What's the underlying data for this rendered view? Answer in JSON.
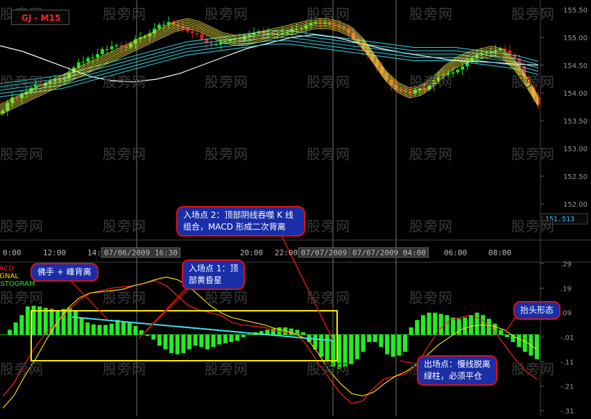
{
  "title": "GJ - M15",
  "watermark": "股旁网",
  "price_axis": {
    "ticks": [
      "155.50",
      "155.00",
      "154.50",
      "154.00",
      "153.50",
      "153.00",
      "152.50",
      "152.00"
    ],
    "current_price": "151.513"
  },
  "time_axis": {
    "labels": [
      "0:00",
      "12:00",
      "14:00",
      "07/06/2009 16:30",
      "20:00",
      "22:00",
      "07/07/2009 01",
      "07/07/2009 04:00",
      "06:00",
      "08:00"
    ]
  },
  "macd_axis": {
    "ticks": [
      ".29",
      ".19",
      ".09",
      "-.01",
      "-.11",
      "-.21",
      "-.31"
    ]
  },
  "legend": {
    "macd": "MACD",
    "signal": "SIGNAL",
    "histogram": "HISTOGRAM"
  },
  "callouts": {
    "entry2_line1": "入场点 2：顶部阴线吞噬 K 线",
    "entry2_line2": "组合，MACD 形成二次背离",
    "hook": "佛手 + 峰背离",
    "entry1_line1": "入场点 1：顶",
    "entry1_line2": "部黄昏星",
    "raise": "抬头形态",
    "exit_line1": "出场点：慢线脱离",
    "exit_line2": "绿柱，必须平仓"
  },
  "colors": {
    "bg": "#000000",
    "bull": "#22dd22",
    "bear": "#dd2222",
    "ma_yellow": "#ffee44",
    "ma_cyan": "#33ddee",
    "ma_white": "#ffffff",
    "macd": "#ff2020",
    "signal": "#ffdd00",
    "hist": "#22ee22",
    "callout_bg": "#1a2ea8",
    "callout_border": "#e01010",
    "box": "#ffee00"
  },
  "chart_data": [
    {
      "type": "candlestick",
      "title": "GJ - M15",
      "ylim": [
        151.4,
        155.6
      ],
      "close": [
        153.68,
        153.82,
        153.92,
        153.91,
        153.98,
        154.02,
        154.1,
        154.17,
        154.13,
        154.18,
        154.21,
        154.23,
        154.24,
        154.26,
        154.36,
        154.46,
        154.55,
        154.56,
        154.63,
        154.64,
        154.7,
        154.79,
        154.79,
        154.84,
        154.86,
        154.84,
        154.82,
        154.89,
        154.97,
        155.0,
        155.02,
        155.07,
        155.16,
        155.23,
        155.23,
        155.28,
        155.23,
        155.2,
        155.17,
        155.11,
        155.08,
        155.06,
        154.97,
        154.9,
        154.88,
        154.88,
        154.92,
        154.93,
        154.96,
        154.97,
        154.96,
        155.03,
        155.05,
        155.08,
        155.11,
        155.07,
        155.08,
        155.06,
        155.06,
        155.08,
        155.1,
        155.15,
        155.15,
        155.16,
        155.22,
        155.26,
        155.27,
        155.26,
        155.27,
        155.23,
        155.22,
        155.19,
        155.16,
        155.08,
        154.97,
        154.89,
        154.77,
        154.68,
        154.59,
        154.47,
        154.36,
        154.24,
        154.14,
        154.07,
        154.04,
        154.02,
        153.99,
        154.05,
        154.08,
        154.06,
        154.13,
        154.22,
        154.28,
        154.32,
        154.35,
        154.37,
        154.42,
        154.48,
        154.56,
        154.63,
        154.69,
        154.72,
        154.73,
        154.74,
        154.77,
        154.8,
        154.77,
        154.69,
        154.62,
        154.48,
        154.29,
        154.12,
        153.93,
        153.79
      ],
      "ma_fast_yellow": [
        153.7,
        153.8,
        153.9,
        154.0,
        154.1,
        154.2,
        154.3,
        154.4,
        154.5,
        154.6,
        154.7,
        154.8,
        154.9,
        155.0,
        155.1,
        155.2,
        155.25,
        155.2,
        155.1,
        155.0,
        154.95,
        154.95,
        155.0,
        155.05,
        155.1,
        155.15,
        155.2,
        155.25,
        155.25,
        155.2,
        155.1,
        154.9,
        154.6,
        154.3,
        154.1,
        154.0,
        154.05,
        154.2,
        154.4,
        154.55,
        154.65,
        154.7,
        154.75,
        154.7,
        154.5,
        154.2,
        153.85
      ],
      "ma_slow_cyan": [
        154.05,
        154.1,
        154.15,
        154.2,
        154.3,
        154.4,
        154.5,
        154.6,
        154.7,
        154.8,
        154.85,
        154.9,
        154.95,
        155.0,
        155.0,
        154.95,
        154.9,
        154.85,
        154.8,
        154.75,
        154.7,
        154.7,
        154.7,
        154.65,
        154.6,
        154.55,
        154.45
      ],
      "ma_slow_white": [
        154.85,
        154.75,
        154.6,
        154.45,
        154.3,
        154.22,
        154.2,
        154.25,
        154.35,
        154.5,
        154.65,
        154.8,
        154.9,
        155.0,
        155.05,
        155.0,
        154.9,
        154.8,
        154.72,
        154.66,
        154.6,
        154.57,
        154.55,
        154.52,
        154.5
      ],
      "yticks": [
        "155.50",
        "155.00",
        "154.50",
        "154.00",
        "153.50",
        "153.00",
        "152.50",
        "152.00"
      ],
      "last_price": "151.513"
    },
    {
      "type": "macd",
      "series_names": [
        "MACD",
        "SIGNAL",
        "HISTOGRAM"
      ],
      "ylim": [
        -0.31,
        0.29
      ],
      "histogram": [
        0.02,
        0.05,
        0.08,
        0.115,
        0.118,
        0.115,
        0.11,
        0.105,
        0.1,
        0.105,
        0.11,
        0.1,
        0.07,
        0.05,
        0.042,
        0.04,
        0.04,
        0.045,
        0.06,
        0.055,
        0.05,
        0.035,
        0.018,
        -0.005,
        -0.02,
        -0.045,
        -0.06,
        -0.075,
        -0.08,
        -0.075,
        -0.06,
        -0.045,
        -0.05,
        -0.06,
        -0.05,
        -0.04,
        -0.035,
        -0.03,
        -0.025,
        -0.01,
        0.002,
        0.01,
        0.015,
        0.02,
        0.025,
        0.03,
        0.03,
        0.025,
        0.02,
        0.01,
        -0.03,
        -0.06,
        -0.09,
        -0.11,
        -0.13,
        -0.14,
        -0.13,
        -0.12,
        -0.1,
        -0.07,
        -0.03,
        -0.03,
        -0.05,
        -0.08,
        -0.09,
        -0.085,
        -0.07,
        0.03,
        0.06,
        0.08,
        0.09,
        0.09,
        0.085,
        0.08,
        0.07,
        0.065,
        0.07,
        0.08,
        0.09,
        0.08,
        0.065,
        0.045,
        0.02,
        -0.01,
        -0.03,
        -0.05,
        -0.07,
        -0.085,
        -0.1
      ],
      "macd": [
        -0.25,
        -0.2,
        -0.12,
        -0.05,
        0.01,
        0.05,
        0.1,
        0.14,
        0.17,
        0.18,
        0.19,
        0.195,
        0.2,
        0.21,
        0.22,
        0.2,
        0.16,
        0.12,
        0.1,
        0.09,
        0.08,
        0.05,
        0.04,
        0.035,
        0.03,
        0.015,
        0.01,
        0.005,
        -0.05,
        -0.12,
        -0.18,
        -0.24,
        -0.28,
        -0.27,
        -0.22,
        -0.18,
        -0.17,
        -0.16,
        -0.12,
        -0.05,
        0.02,
        0.06,
        0.07,
        0.08,
        0.06,
        0.02,
        -0.04,
        -0.1,
        -0.15,
        -0.18
      ],
      "signal": [
        -0.3,
        -0.25,
        -0.17,
        -0.1,
        -0.02,
        0.05,
        0.11,
        0.15,
        0.17,
        0.175,
        0.18,
        0.185,
        0.2,
        0.21,
        0.225,
        0.235,
        0.225,
        0.2,
        0.16,
        0.12,
        0.09,
        0.07,
        0.06,
        0.05,
        0.04,
        0.025,
        0.015,
        0.0,
        -0.02,
        -0.08,
        -0.15,
        -0.2,
        -0.24,
        -0.25,
        -0.235,
        -0.2,
        -0.17,
        -0.15,
        -0.12,
        -0.08,
        -0.04,
        -0.01,
        0.02,
        0.035,
        0.04,
        0.035,
        0.02,
        -0.01,
        -0.03,
        -0.06
      ],
      "yticks": [
        ".29",
        ".19",
        ".09",
        "-.01",
        "-.11",
        "-.21",
        "-.31"
      ]
    }
  ]
}
